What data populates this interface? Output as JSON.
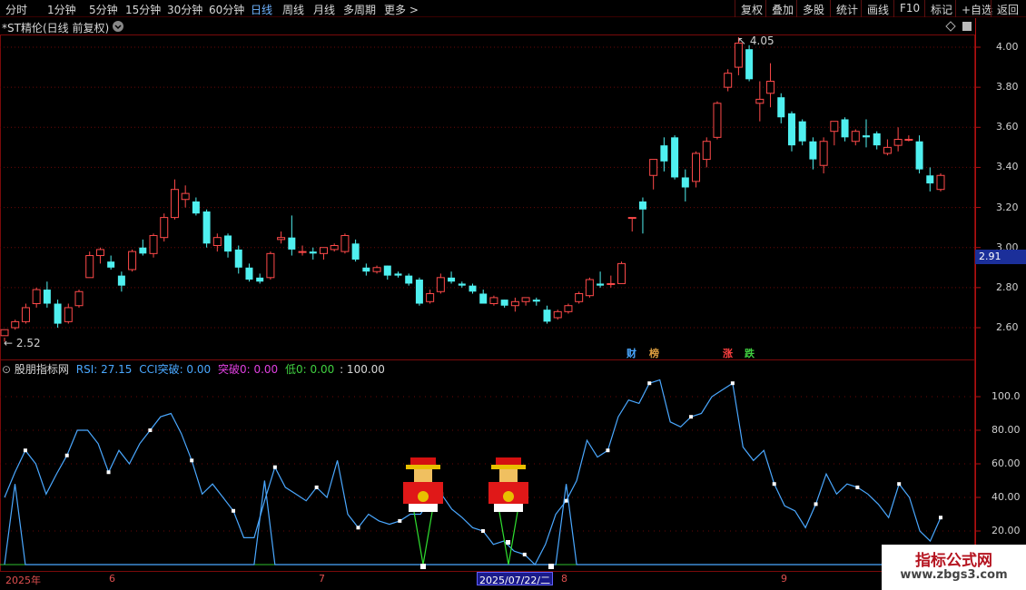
{
  "toolbar": {
    "timeframes": [
      "分时",
      "1分钟",
      "5分钟",
      "15分钟",
      "30分钟",
      "60分钟",
      "日线",
      "周线",
      "月线",
      "多周期",
      "更多 >"
    ],
    "active_timeframe": "日线",
    "buttons": [
      "复权",
      "叠加",
      "多股",
      "统计",
      "画线",
      "F10",
      "标记",
      "+自选",
      "返回"
    ]
  },
  "stock": {
    "title": "*ST精伦(日线 前复权)",
    "high_marker": "4.05",
    "low_marker": "2.52",
    "current_price": "2.91"
  },
  "price_axis": {
    "labels": [
      "4.00",
      "3.80",
      "3.60",
      "3.40",
      "3.20",
      "3.00",
      "2.80",
      "2.60"
    ]
  },
  "event_markers": [
    {
      "text": "财",
      "color": "#4aa8ff"
    },
    {
      "text": "榜",
      "color": "#e0a040"
    },
    {
      "text": "涨",
      "color": "#ff4040"
    },
    {
      "text": "跌",
      "color": "#40d040"
    }
  ],
  "indicator": {
    "name": "股朋指标网",
    "rsi_label": "RSI: 27.15",
    "cci_label": "CCI突破: 0.00",
    "break_label": "突破0: 0.00",
    "low_label": "低0: 0.00",
    "hundred_label": ": 100.00",
    "axis_labels": [
      "100.0",
      "80.00",
      "60.00",
      "40.00",
      "20.00"
    ]
  },
  "dates": {
    "labels": [
      "2025年",
      "6",
      "7",
      "8",
      "9"
    ],
    "selected": "2025/07/22/二"
  },
  "watermark": {
    "title": "指标公式网",
    "url": "www.zbgs3.com"
  },
  "chart_data": {
    "type": "candlestick",
    "candles": [
      [
        2.56,
        2.59,
        2.55,
        2.53
      ],
      [
        2.6,
        2.63,
        2.64,
        2.59
      ],
      [
        2.63,
        2.7,
        2.72,
        2.62
      ],
      [
        2.72,
        2.79,
        2.8,
        2.7
      ],
      [
        2.79,
        2.72,
        2.83,
        2.7
      ],
      [
        2.72,
        2.62,
        2.74,
        2.6
      ],
      [
        2.63,
        2.7,
        2.72,
        2.62
      ],
      [
        2.71,
        2.78,
        2.79,
        2.7
      ],
      [
        2.85,
        2.96,
        2.98,
        2.85
      ],
      [
        2.96,
        2.99,
        3.0,
        2.92
      ],
      [
        2.93,
        2.9,
        2.96,
        2.89
      ],
      [
        2.86,
        2.81,
        2.88,
        2.78
      ],
      [
        2.89,
        2.98,
        2.99,
        2.88
      ],
      [
        3.0,
        2.97,
        3.04,
        2.96
      ],
      [
        2.97,
        3.06,
        3.07,
        2.95
      ],
      [
        3.05,
        3.15,
        3.17,
        3.03
      ],
      [
        3.15,
        3.29,
        3.34,
        3.14
      ],
      [
        3.24,
        3.27,
        3.31,
        3.2
      ],
      [
        3.23,
        3.17,
        3.25,
        3.16
      ],
      [
        3.18,
        3.02,
        3.19,
        3.0
      ],
      [
        3.01,
        3.05,
        3.07,
        2.98
      ],
      [
        3.06,
        2.98,
        3.07,
        2.95
      ],
      [
        2.99,
        2.9,
        3.01,
        2.87
      ],
      [
        2.9,
        2.84,
        2.92,
        2.83
      ],
      [
        2.85,
        2.83,
        2.87,
        2.82
      ],
      [
        2.85,
        2.97,
        2.98,
        2.84
      ],
      [
        3.04,
        3.05,
        3.08,
        3.02
      ],
      [
        3.05,
        2.99,
        3.16,
        2.96
      ],
      [
        2.98,
        2.98,
        3.01,
        2.96
      ],
      [
        2.98,
        2.97,
        3.0,
        2.94
      ],
      [
        2.97,
        3.0,
        3.0,
        2.94
      ],
      [
        2.99,
        3.01,
        3.02,
        2.98
      ],
      [
        2.98,
        3.06,
        3.07,
        2.97
      ],
      [
        3.02,
        2.94,
        3.04,
        2.93
      ],
      [
        2.9,
        2.88,
        2.92,
        2.86
      ],
      [
        2.88,
        2.9,
        2.91,
        2.87
      ],
      [
        2.91,
        2.86,
        2.91,
        2.84
      ],
      [
        2.87,
        2.86,
        2.88,
        2.85
      ],
      [
        2.86,
        2.82,
        2.87,
        2.81
      ],
      [
        2.84,
        2.72,
        2.85,
        2.71
      ],
      [
        2.73,
        2.77,
        2.79,
        2.72
      ],
      [
        2.78,
        2.85,
        2.87,
        2.77
      ],
      [
        2.85,
        2.83,
        2.88,
        2.82
      ],
      [
        2.82,
        2.81,
        2.83,
        2.8
      ],
      [
        2.81,
        2.78,
        2.82,
        2.77
      ],
      [
        2.77,
        2.72,
        2.79,
        2.72
      ],
      [
        2.72,
        2.75,
        2.76,
        2.71
      ],
      [
        2.74,
        2.71,
        2.74,
        2.7
      ],
      [
        2.71,
        2.73,
        2.75,
        2.68
      ],
      [
        2.73,
        2.75,
        2.75,
        2.71
      ],
      [
        2.74,
        2.73,
        2.75,
        2.71
      ],
      [
        2.69,
        2.63,
        2.71,
        2.62
      ],
      [
        2.65,
        2.68,
        2.69,
        2.64
      ],
      [
        2.68,
        2.71,
        2.72,
        2.67
      ],
      [
        2.73,
        2.77,
        2.78,
        2.72
      ],
      [
        2.76,
        2.84,
        2.85,
        2.75
      ],
      [
        2.82,
        2.81,
        2.88,
        2.8
      ],
      [
        2.82,
        2.82,
        2.86,
        2.8
      ],
      [
        2.82,
        2.92,
        2.93,
        2.82
      ],
      [
        3.15,
        3.15,
        3.15,
        3.08
      ],
      [
        3.23,
        3.19,
        3.25,
        3.07
      ],
      [
        3.36,
        3.44,
        3.44,
        3.29
      ],
      [
        3.51,
        3.43,
        3.55,
        3.38
      ],
      [
        3.55,
        3.35,
        3.56,
        3.34
      ],
      [
        3.35,
        3.3,
        3.39,
        3.23
      ],
      [
        3.33,
        3.47,
        3.48,
        3.3
      ],
      [
        3.44,
        3.53,
        3.55,
        3.4
      ],
      [
        3.55,
        3.72,
        3.73,
        3.54
      ],
      [
        3.8,
        3.87,
        3.89,
        3.78
      ],
      [
        3.9,
        4.02,
        4.05,
        3.86
      ],
      [
        3.99,
        3.84,
        4.01,
        3.83
      ],
      [
        3.72,
        3.74,
        3.83,
        3.63
      ],
      [
        3.77,
        3.83,
        3.92,
        3.7
      ],
      [
        3.75,
        3.65,
        3.77,
        3.62
      ],
      [
        3.67,
        3.51,
        3.68,
        3.48
      ],
      [
        3.63,
        3.53,
        3.64,
        3.51
      ],
      [
        3.53,
        3.44,
        3.55,
        3.39
      ],
      [
        3.41,
        3.53,
        3.55,
        3.37
      ],
      [
        3.58,
        3.63,
        3.63,
        3.51
      ],
      [
        3.64,
        3.55,
        3.65,
        3.53
      ],
      [
        3.53,
        3.58,
        3.59,
        3.51
      ],
      [
        3.56,
        3.55,
        3.64,
        3.5
      ],
      [
        3.57,
        3.51,
        3.58,
        3.49
      ],
      [
        3.47,
        3.5,
        3.54,
        3.46
      ],
      [
        3.51,
        3.54,
        3.6,
        3.48
      ],
      [
        3.54,
        3.54,
        3.56,
        3.53
      ],
      [
        3.53,
        3.39,
        3.56,
        3.37
      ],
      [
        3.36,
        3.32,
        3.4,
        3.28
      ],
      [
        3.29,
        3.36,
        3.37,
        3.28
      ]
    ],
    "rsi": [
      40,
      55,
      68,
      60,
      42,
      54,
      65,
      80,
      80,
      72,
      55,
      68,
      60,
      72,
      80,
      88,
      90,
      78,
      62,
      42,
      48,
      40,
      32,
      16,
      16,
      38,
      58,
      46,
      42,
      38,
      46,
      40,
      62,
      30,
      22,
      30,
      26,
      24,
      26,
      30,
      30,
      40,
      42,
      33,
      28,
      22,
      20,
      12,
      14,
      8,
      6,
      -2,
      12,
      30,
      38,
      50,
      74,
      64,
      68,
      88,
      98,
      96,
      108,
      110,
      85,
      82,
      88,
      90,
      100,
      104,
      108,
      70,
      62,
      68,
      48,
      35,
      32,
      22,
      36,
      54,
      42,
      48,
      46,
      42,
      36,
      28,
      48,
      40,
      20,
      14,
      28
    ],
    "cci": [
      0,
      48,
      0,
      0,
      0,
      0,
      0,
      0,
      0,
      0,
      0,
      0,
      0,
      0,
      0,
      0,
      0,
      0,
      0,
      0,
      0,
      0,
      0,
      0,
      0,
      50,
      0,
      0,
      0,
      0,
      0,
      0,
      0,
      0,
      0,
      0,
      0,
      0,
      0,
      0,
      0,
      0,
      0,
      0,
      0,
      0,
      0,
      0,
      0,
      0,
      0,
      0,
      0,
      0,
      48,
      0,
      0,
      0,
      0,
      0,
      0,
      0,
      0,
      0,
      0,
      0,
      0,
      0,
      0,
      0,
      0,
      0,
      0,
      0,
      0,
      0,
      0,
      0,
      0,
      0,
      0,
      0,
      0,
      0,
      0,
      0,
      0,
      0,
      0,
      0,
      0
    ],
    "ylim_price": [
      2.5,
      4.15
    ],
    "ylim_indicator": [
      0,
      120
    ]
  }
}
